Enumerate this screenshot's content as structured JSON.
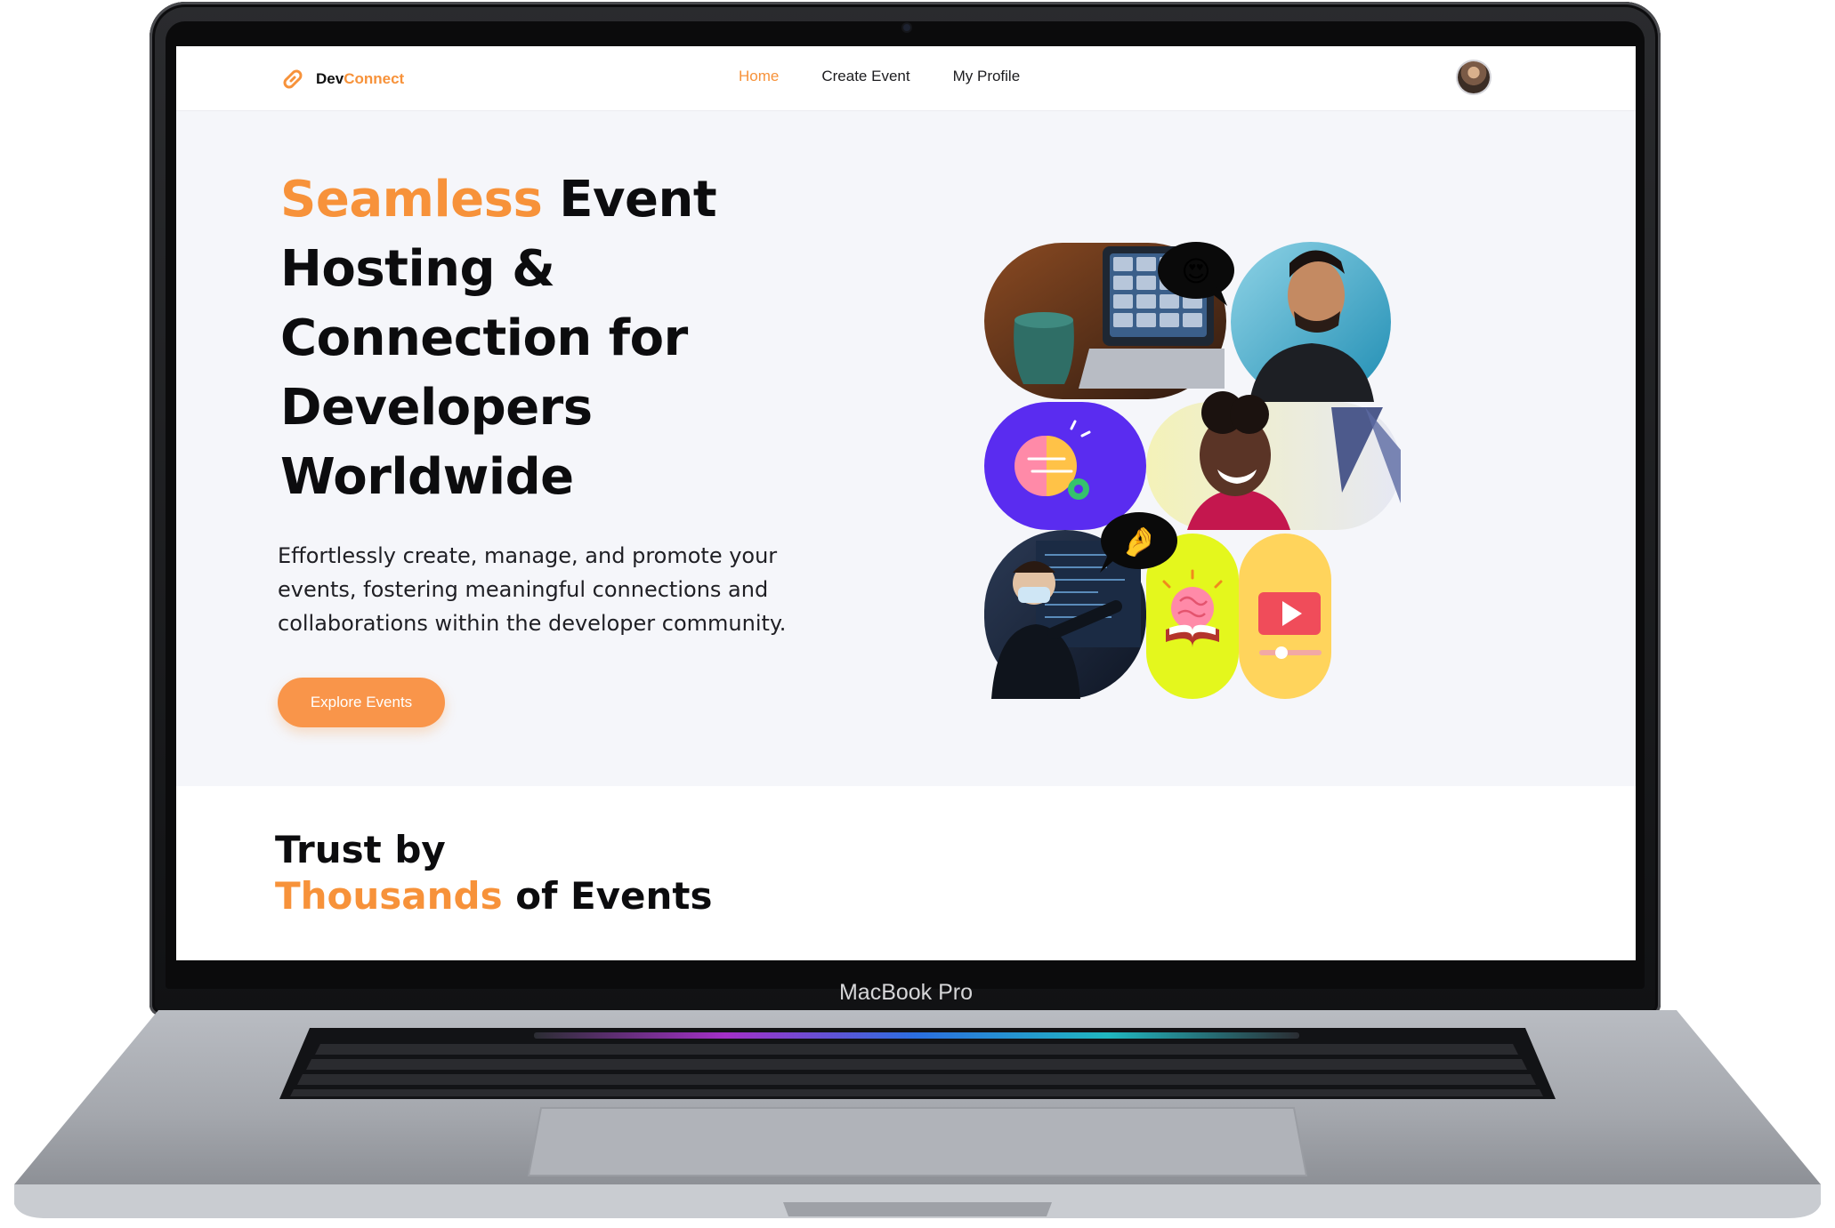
{
  "device": {
    "model_label": "MacBook Pro"
  },
  "nav": {
    "brand_part1": "Dev",
    "brand_part2": "Connect",
    "links": [
      {
        "label": "Home",
        "active": true
      },
      {
        "label": "Create Event",
        "active": false
      },
      {
        "label": "My Profile",
        "active": false
      }
    ],
    "avatar_icon": "user-avatar"
  },
  "hero": {
    "title_accent": "Seamless",
    "title_rest": " Event Hosting & Connection for Developers Worldwide",
    "description": "Effortlessly create, manage, and promote your events, fostering meaningful connections and collaborations within the developer community.",
    "cta_label": "Explore Events",
    "bubble_emojis": [
      "😍",
      "🤌"
    ]
  },
  "trust": {
    "line1": "Trust by",
    "line2_accent": "Thousands",
    "line2_rest": " of Events"
  },
  "colors": {
    "accent": "#f7923a",
    "hero_bg": "#f5f6fa",
    "collage_purple": "#5a2cf0",
    "collage_lime": "#e4f71d",
    "collage_yellow": "#ffd45c"
  }
}
